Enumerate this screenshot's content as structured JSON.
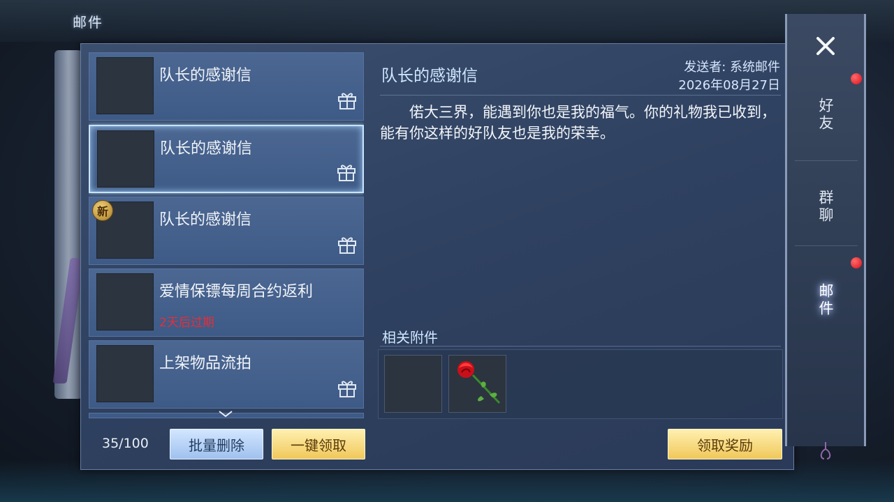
{
  "window": {
    "title": "邮件"
  },
  "mail_list": {
    "items": [
      {
        "title": "队长的感谢信",
        "has_gift": true,
        "selected": false,
        "is_new": false,
        "sub": ""
      },
      {
        "title": "队长的感谢信",
        "has_gift": true,
        "selected": true,
        "is_new": false,
        "sub": ""
      },
      {
        "title": "队长的感谢信",
        "has_gift": true,
        "selected": false,
        "is_new": true,
        "sub": ""
      },
      {
        "title": "爱情保镖每周合约返利",
        "has_gift": false,
        "selected": false,
        "is_new": false,
        "sub": "2天后过期"
      },
      {
        "title": "上架物品流拍",
        "has_gift": true,
        "selected": false,
        "is_new": false,
        "sub": ""
      }
    ],
    "new_badge": "新",
    "count": "35/100"
  },
  "buttons": {
    "batch_delete": "批量删除",
    "claim_all": "一键领取",
    "claim_reward": "领取奖励"
  },
  "detail": {
    "title": "队长的感谢信",
    "sender": "发送者: 系统邮件",
    "date": "2026年08月27日",
    "body": "偌大三界，能遇到你也是我的福气。你的礼物我已收到，能有你这样的好队友也是我的荣幸。",
    "attachments_label": "相关附件",
    "attachments": [
      {
        "icon": "empty-slot"
      },
      {
        "icon": "rose-icon"
      }
    ]
  },
  "side_tabs": [
    {
      "label": "好友",
      "active": false,
      "has_dot": true
    },
    {
      "label": "群聊",
      "active": false,
      "has_dot": false
    },
    {
      "label": "邮件",
      "active": true,
      "has_dot": true
    }
  ],
  "colors": {
    "gold_button": "#f0c85a",
    "blue_button": "#9fc1ee",
    "expiry_red": "#e0303c",
    "notification_red": "#d8101c"
  }
}
